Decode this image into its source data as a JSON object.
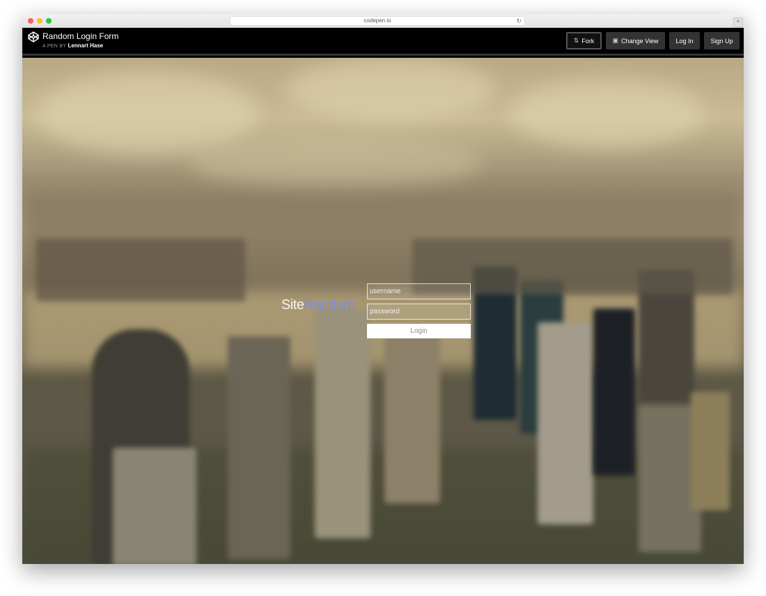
{
  "browser": {
    "url": "codepen.io",
    "reload_icon": "reload-icon",
    "new_tab": "+"
  },
  "header": {
    "title": "Random Login Form",
    "by_label": "A PEN BY",
    "author": "Lennart Hase",
    "buttons": {
      "fork": "Fork",
      "change_view": "Change View",
      "log_in": "Log In",
      "sign_up": "Sign Up"
    },
    "icons": {
      "logo": "codepen-logo-icon",
      "fork": "fork-icon",
      "change_view": "layout-icon"
    }
  },
  "login": {
    "brand_primary": "Site",
    "brand_accent": "Random",
    "username_placeholder": "username",
    "password_placeholder": "password",
    "submit_label": "Login"
  },
  "colors": {
    "accent": "#7b8de0",
    "header_bg": "#000000",
    "button_bg": "#333333"
  }
}
